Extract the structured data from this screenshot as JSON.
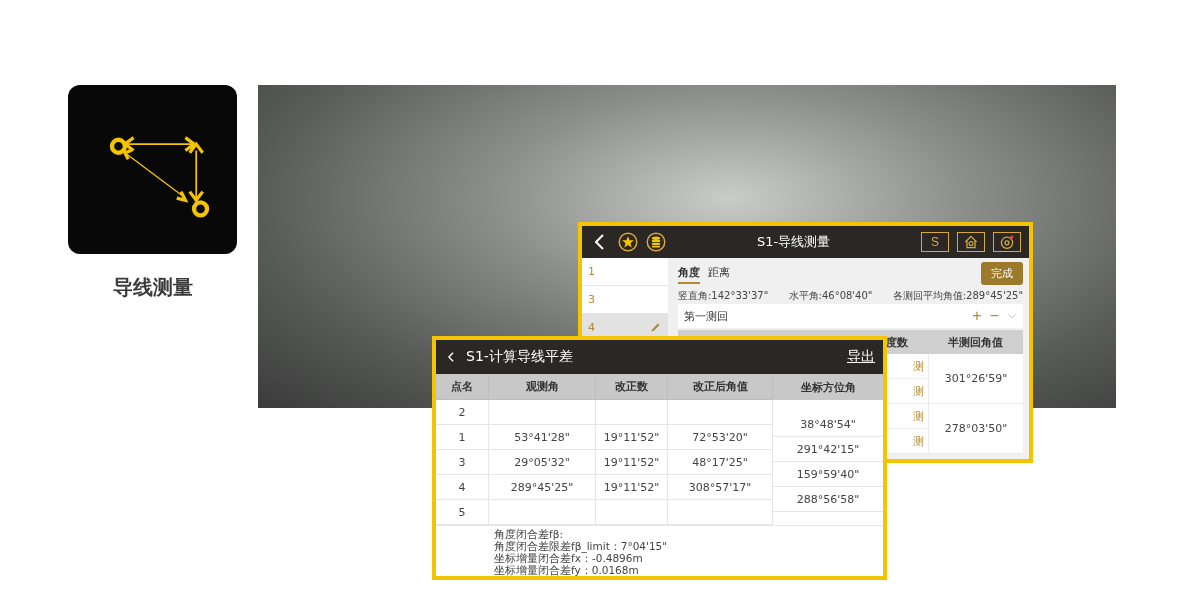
{
  "app_tile": {
    "label": "导线测量"
  },
  "back_screen": {
    "title": "S1-导线测量",
    "s_button": "S",
    "points": [
      {
        "label": "1",
        "selected": false
      },
      {
        "label": "3",
        "selected": false
      },
      {
        "label": "4",
        "selected": true
      }
    ],
    "tabs": [
      {
        "label": "角度",
        "selected": true
      },
      {
        "label": "距离",
        "selected": false
      }
    ],
    "done_button": "完成",
    "readings": [
      "竖直角:142°33'37\"",
      "水平角:46°08'40\"",
      "各测回平均角值:289°45'25\""
    ],
    "round": {
      "label": "第一测回",
      "add": "+",
      "remove": "−"
    },
    "columns": [
      "度数",
      "半测回角值"
    ],
    "measure_buttons": [
      "测",
      "测",
      "测",
      "测"
    ],
    "half_round_values": [
      "301°26'59\"",
      "278°03'50\""
    ]
  },
  "front_screen": {
    "title": "S1-计算导线平差",
    "export": "导出",
    "columns": [
      "点名",
      "观测角",
      "改正数",
      "改正后角值",
      "坐标方位角"
    ],
    "rows": [
      {
        "point": "2"
      },
      {
        "point": "1",
        "observed": "53°41'28\"",
        "correction": "19°11'52\"",
        "corrected": "72°53'20\""
      },
      {
        "point": "3",
        "observed": "29°05'32\"",
        "correction": "19°11'52\"",
        "corrected": "48°17'25\""
      },
      {
        "point": "4",
        "observed": "289°45'25\"",
        "correction": "19°11'52\"",
        "corrected": "308°57'17\""
      },
      {
        "point": "5"
      }
    ],
    "azimuths": [
      "38°48'54\"",
      "291°42'15\"",
      "159°59'40\"",
      "288°56'58\""
    ],
    "summary": [
      "角度闭合差fβ:",
      "角度闭合差限差fβ_limit：7°04'15\"",
      "坐标增量闭合差fx：-0.4896m",
      "坐标增量闭合差fy：0.0168m"
    ]
  }
}
